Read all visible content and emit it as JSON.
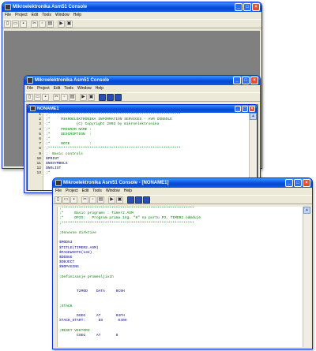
{
  "windows": [
    {
      "title": "Mikroelektronika Asm51 Console",
      "menu": [
        "File",
        "Project",
        "Edit",
        "Tools",
        "Window",
        "Help"
      ]
    },
    {
      "title": "Mikroelektronika Asm51 Console",
      "menu": [
        "File",
        "Project",
        "Edit",
        "Tools",
        "Window",
        "Help"
      ],
      "child": {
        "title": "NONAME1",
        "lines": [
          {
            "n": "1",
            "t": ";*************************************************************",
            "k": "cmt"
          },
          {
            "n": "2",
            "t": ";*     MIKROELEKTRONIKA INFORMATION SERVICES - AVR CONSOLE",
            "k": "cmt"
          },
          {
            "n": "3",
            "t": ";*            (C) Copyright 2003 by mikroelektronika",
            "k": "cmt"
          },
          {
            "n": "4",
            "t": ";*     PROGRAM NAME :",
            "k": "cmt"
          },
          {
            "n": "5",
            "t": ";*     DESCRIPTION  :",
            "k": "cmt"
          },
          {
            "n": "6",
            "t": ";*",
            "k": "cmt"
          },
          {
            "n": "7",
            "t": ";*     NOTE         :",
            "k": "cmt"
          },
          {
            "n": "8",
            "t": ";*************************************************************",
            "k": "cmt"
          },
          {
            "n": "9",
            "t": ";  Basic controls",
            "k": "cmt"
          },
          {
            "n": "10",
            "t": "$PRINT",
            "k": "dir"
          },
          {
            "n": "11",
            "t": "$NOSYMBOLS",
            "k": "dir"
          },
          {
            "n": "12",
            "t": "$NOLIST",
            "k": "dir"
          },
          {
            "n": "13",
            "t": ";*",
            "k": "cmt"
          }
        ]
      }
    },
    {
      "title": "Mikroelektronika Asm51 Console - [NONAME1]",
      "menu": [
        "File",
        "Project",
        "Edit",
        "Tools",
        "Window",
        "Help"
      ],
      "lines": [
        {
          "t": ";*************************************************************",
          "k": "cmt"
        },
        {
          "t": ";*     Basic programs : Timer2.ASM",
          "k": "cmt"
        },
        {
          "t": ";*     OPIS:   Program prima ing. \"0\" na portu P3, TIMER2 odmduje",
          "k": "cmt"
        },
        {
          "t": ";*************************************************************",
          "k": "cmt"
        },
        {
          "t": "",
          "k": ""
        },
        {
          "t": ";Osnovne dirktive",
          "k": "cmt"
        },
        {
          "t": "",
          "k": ""
        },
        {
          "t": "$MOD53",
          "k": "dir"
        },
        {
          "t": "$TITLE(TIMER2.ASM)",
          "k": "dir"
        },
        {
          "t": "$PAGEWIDTH(132)",
          "k": "dir"
        },
        {
          "t": "$DEBUG",
          "k": "dir"
        },
        {
          "t": "$OBJECT",
          "k": "dir"
        },
        {
          "t": "$NOPAGING",
          "k": "dir"
        },
        {
          "t": "",
          "k": ""
        },
        {
          "t": ";Definisanje promenljivih",
          "k": "cmt"
        },
        {
          "t": "",
          "k": ""
        },
        {
          "t": "",
          "k": ""
        },
        {
          "t": "        T2MOD    DATA     0C9H",
          "k": "dir"
        },
        {
          "t": "",
          "k": ""
        },
        {
          "t": "",
          "k": ""
        },
        {
          "t": ";STACK",
          "k": "cmt"
        },
        {
          "t": "",
          "k": ""
        },
        {
          "t": "        DSEG     AT       03FH",
          "k": "dir"
        },
        {
          "t": "STACK_START:      DS       040H",
          "k": "dir"
        },
        {
          "t": "",
          "k": ""
        },
        {
          "t": ";RESET VEKTORI",
          "k": "cmt"
        },
        {
          "t": "        CSEG     AT       0",
          "k": "dir"
        }
      ]
    }
  ]
}
